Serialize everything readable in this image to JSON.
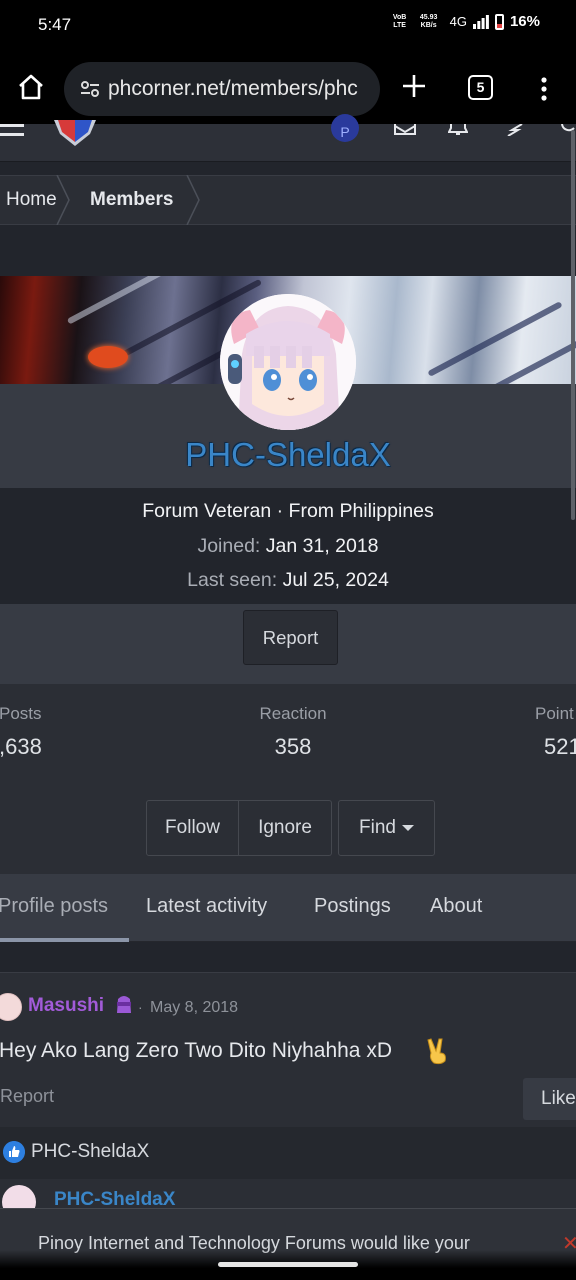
{
  "status_bar": {
    "time": "5:47",
    "volte": "VoB LTE",
    "speed_value": "45.93",
    "speed_unit": "KB/s",
    "network": "4G",
    "battery": "16%"
  },
  "browser": {
    "url": "phcorner.net/members/phc",
    "tab_count": "5"
  },
  "breadcrumb": {
    "items": [
      {
        "label": "Home"
      },
      {
        "label": "Members"
      }
    ]
  },
  "profile": {
    "username": "PHC-SheldaX",
    "title_line": "Forum Veteran · From Philippines",
    "joined_label": "Joined:",
    "joined_value": "Jan 31, 2018",
    "last_seen_label": "Last seen:",
    "last_seen_value": "Jul 25, 2024",
    "report_label": "Report"
  },
  "stats": [
    {
      "label": "Posts",
      "value": ",638"
    },
    {
      "label": "Reaction",
      "value": "358"
    },
    {
      "label": "Point",
      "value": "521"
    }
  ],
  "actions": {
    "follow": "Follow",
    "ignore": "Ignore",
    "find": "Find"
  },
  "tabs": [
    {
      "label": "Profile posts",
      "active": true
    },
    {
      "label": "Latest activity",
      "active": false
    },
    {
      "label": "Postings",
      "active": false
    },
    {
      "label": "About",
      "active": false
    }
  ],
  "post": {
    "author": "Masushi",
    "separator": "·",
    "date": "May 8, 2018",
    "message": "Hey Ako Lang Zero Two Dito Niyhahha xD",
    "report_label": "Report",
    "like_label": "Like",
    "reacted_by": "PHC-SheldaX",
    "reply_author": "PHC-SheldaX"
  },
  "cookie_notice": {
    "text": "Pinoy Internet and Technology Forums would like your",
    "close": "✕"
  },
  "colors": {
    "username": "#3a86c8",
    "post_author": "#a25bd8",
    "page_bg": "#22252c"
  }
}
